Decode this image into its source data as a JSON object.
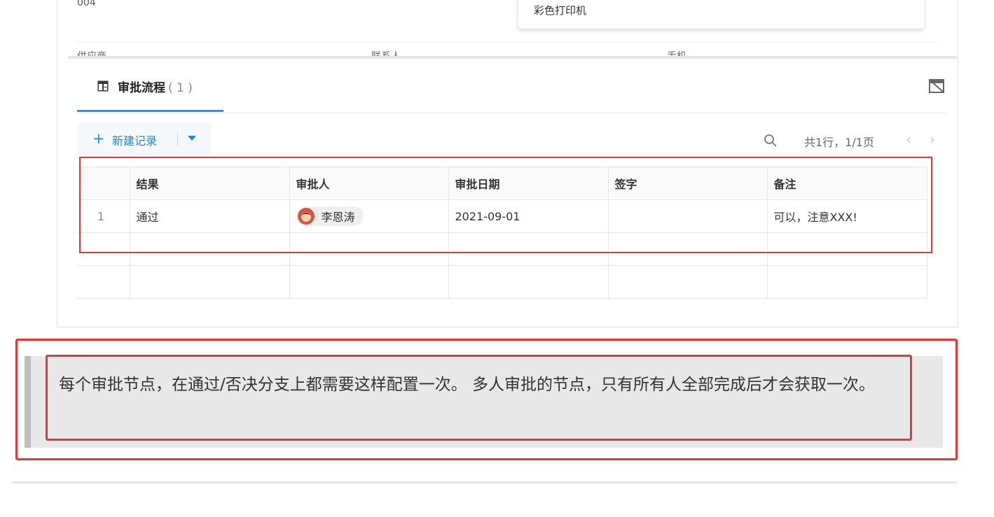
{
  "top_form": {
    "code_value": "004",
    "dropdown_option": "彩色打印机",
    "peek_fields": [
      "供应商",
      "联系人",
      "手机"
    ]
  },
  "section_tab": {
    "label": "审批流程",
    "count": "( 1 )"
  },
  "toolbar": {
    "new_record_label": "新建记录",
    "page_info": "共1行，1/1页",
    "prev_glyph": "‹",
    "next_glyph": "›",
    "icons": [
      "table-icon",
      "hide-section-icon",
      "plus-icon",
      "caret-down-icon",
      "search-icon",
      "chevron-left-icon",
      "chevron-right-icon"
    ]
  },
  "grid": {
    "columns": [
      "结果",
      "审批人",
      "审批日期",
      "签字",
      "备注"
    ],
    "rows": [
      {
        "index": "1",
        "result": "通过",
        "approver": "李恩涛",
        "date": "2021-09-01",
        "signature": "",
        "note": "可以，注意XXX!"
      }
    ]
  },
  "note_block": {
    "text": "每个审批节点，在通过/否决分支上都需要这样配置一次。 多人审批的节点，只有所有人全部完成后才会获取一次。"
  },
  "colors": {
    "accent": "#1e88e5",
    "tab_underline": "#2196f3",
    "highlight_red": "#e53935",
    "note_bg": "#e8e8e8"
  }
}
